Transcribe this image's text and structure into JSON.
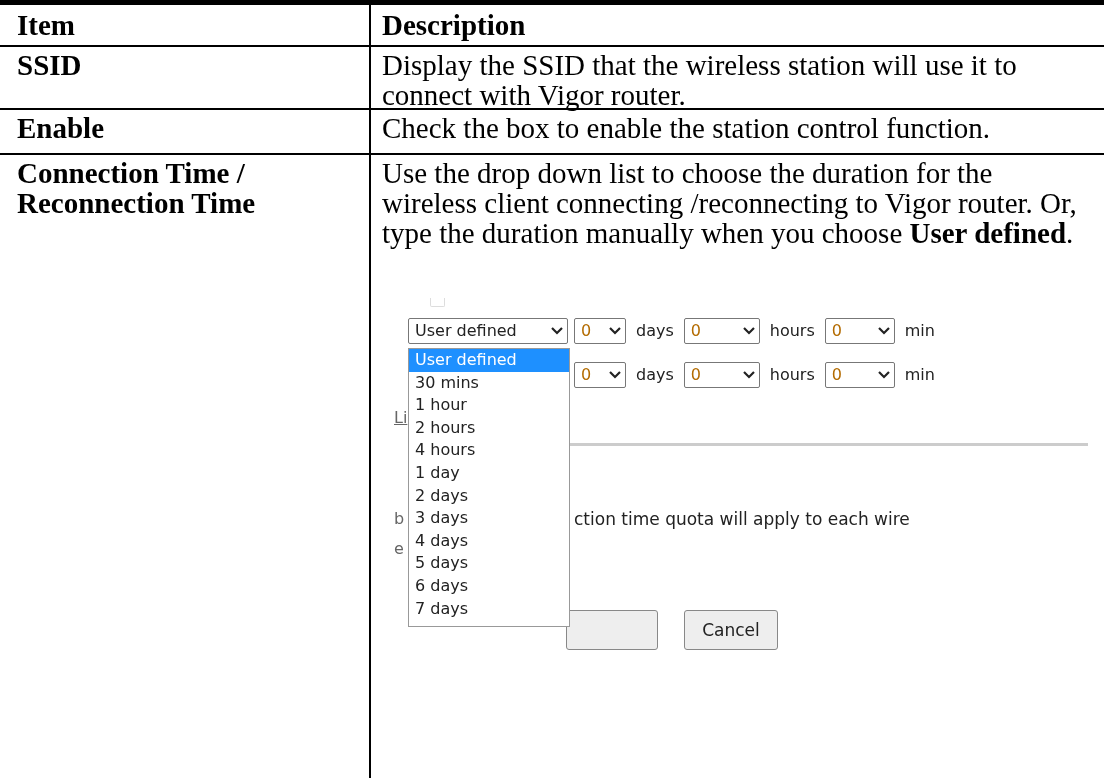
{
  "table": {
    "columns": [
      "Item",
      "Description"
    ],
    "rows": [
      {
        "item": "SSID",
        "description": "Display the SSID that the wireless station will use it to connect with Vigor router."
      },
      {
        "item": "Enable",
        "description": "Check the box to enable the station control function."
      },
      {
        "item": "Connection Time / Reconnection Time",
        "description": "Use the drop down list to choose the duration for the wireless client connecting /reconnecting to Vigor router. Or, type the duration manually when you choose **User defined**.",
        "screenshot": {
          "time_rows": [
            {
              "preset": "User defined",
              "days": "0",
              "days_label": "days",
              "hours": "0",
              "hours_label": "hours",
              "min": "0",
              "min_label": "min"
            },
            {
              "days": "0",
              "days_label": "days",
              "hours": "0",
              "hours_label": "hours",
              "min": "0",
              "min_label": "min"
            }
          ],
          "dropdown": [
            {
              "label": "User defined",
              "selected": true
            },
            {
              "label": "30 mins",
              "selected": false
            },
            {
              "label": "1 hour",
              "selected": false
            },
            {
              "label": "2 hours",
              "selected": false
            },
            {
              "label": "4 hours",
              "selected": false
            },
            {
              "label": "1 day",
              "selected": false
            },
            {
              "label": "2 days",
              "selected": false
            },
            {
              "label": "3 days",
              "selected": false
            },
            {
              "label": "4 days",
              "selected": false
            },
            {
              "label": "5 days",
              "selected": false
            },
            {
              "label": "6 days",
              "selected": false
            },
            {
              "label": "7 days",
              "selected": false
            }
          ],
          "link_fragment": "Li",
          "note_fragment_1": "b",
          "note_fragment_2": "e",
          "note_text": "ction time quota will apply to each wire",
          "buttons": [
            "Cancel"
          ]
        }
      }
    ]
  }
}
